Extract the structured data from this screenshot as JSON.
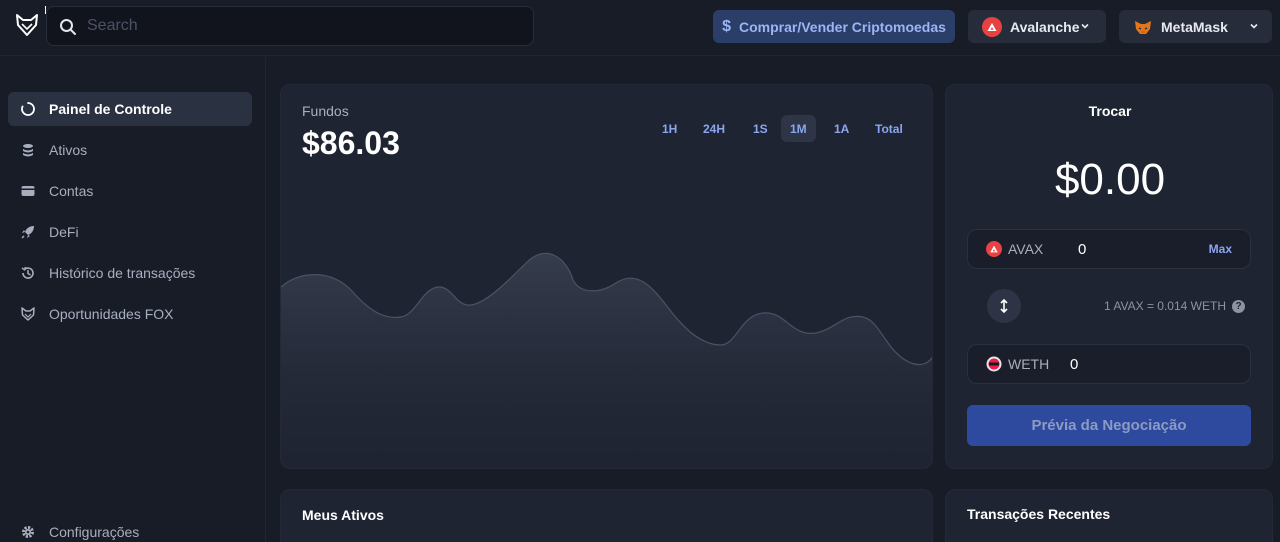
{
  "topbar": {
    "search_placeholder": "Search",
    "buy_sell_label": "Comprar/Vender Criptomoedas",
    "buy_icon": "$",
    "chain_label": "Avalanche",
    "wallet_label": "MetaMask"
  },
  "sidebar": {
    "items": [
      {
        "label": "Painel de Controle",
        "icon": "dashboard-icon",
        "active": true
      },
      {
        "label": "Ativos",
        "icon": "coins-icon"
      },
      {
        "label": "Contas",
        "icon": "wallet-icon"
      },
      {
        "label": "DeFi",
        "icon": "rocket-icon"
      },
      {
        "label": "Histórico de transações",
        "icon": "history-icon"
      },
      {
        "label": "Oportunidades FOX",
        "icon": "fox-icon"
      }
    ],
    "settings_label": "Configurações"
  },
  "portfolio": {
    "label": "Fundos",
    "value": "$86.03",
    "ranges": [
      "1H",
      "24H",
      "1S",
      "1M",
      "1A",
      "Total"
    ],
    "active_range": "1M"
  },
  "trade": {
    "title": "Trocar",
    "amount": "$0.00",
    "from_asset": "AVAX",
    "from_value": "0",
    "max_label": "Max",
    "rate": "1 AVAX = 0.014 WETH",
    "to_asset": "WETH",
    "to_value": "0",
    "preview_label": "Prévia da Negociação"
  },
  "assets": {
    "title": "Meus Ativos"
  },
  "transactions": {
    "title": "Transações Recentes"
  },
  "colors": {
    "accent": "#2e4a9e",
    "avax": "#e84142",
    "link": "#8aa6f0"
  }
}
